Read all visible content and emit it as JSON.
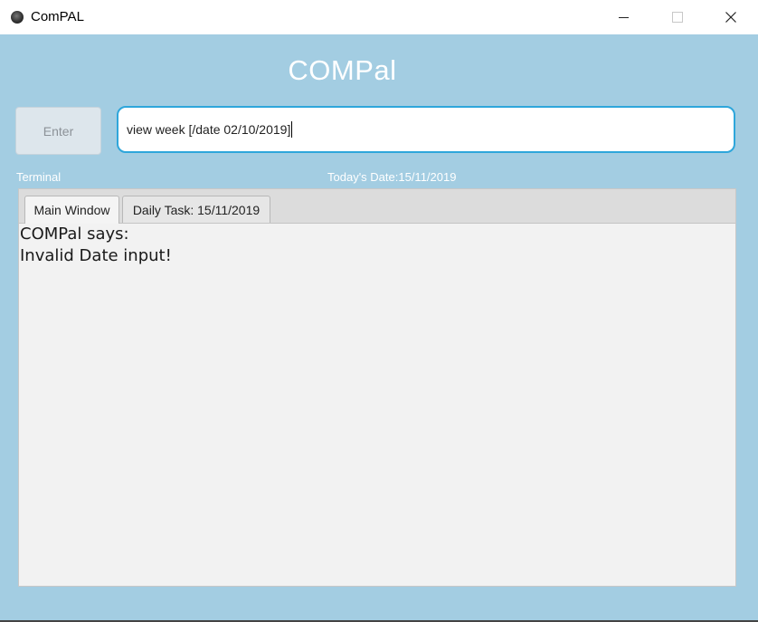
{
  "window": {
    "title": "ComPAL",
    "icon": "app-icon",
    "controls": [
      "minimize-icon",
      "maximize-icon",
      "close-icon"
    ]
  },
  "app": {
    "heading": "COMPal",
    "enter_label": "Enter",
    "command_value": "view week [/date 02/10/2019]",
    "terminal_label": "Terminal",
    "todays_date_label": "Today's Date:15/11/2019",
    "tabs": [
      {
        "label": "Main Window",
        "selected": true
      },
      {
        "label": "Daily Task: 15/11/2019",
        "selected": false
      }
    ],
    "output_lines": [
      "COMPal says:",
      "Invalid Date input!"
    ]
  },
  "colors": {
    "background": "#a3cde2",
    "input_border": "#2ea6db",
    "pane": "#f2f2f2"
  }
}
